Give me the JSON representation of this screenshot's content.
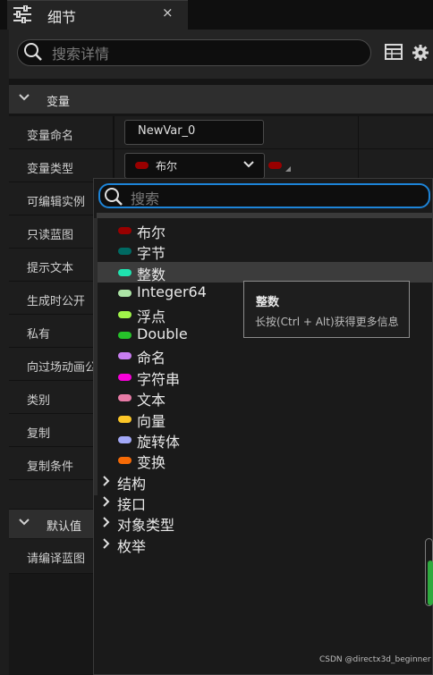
{
  "tab": {
    "title": "细节",
    "close_label": "×",
    "icon": "sliders-icon"
  },
  "search": {
    "placeholder": "搜索详情",
    "icon": "search-icon"
  },
  "toolbar": {
    "table_icon": "table-icon",
    "gear_icon": "gear-icon"
  },
  "variable_category": {
    "label": "变量"
  },
  "rows": [
    {
      "label": "变量命名"
    },
    {
      "label": "变量类型"
    },
    {
      "label": "可编辑实例"
    },
    {
      "label": "只读蓝图"
    },
    {
      "label": "提示文本"
    },
    {
      "label": "生成时公开"
    },
    {
      "label": "私有"
    },
    {
      "label": "向过场动画公"
    },
    {
      "label": "类别"
    },
    {
      "label": "复制"
    },
    {
      "label": "复制条件"
    }
  ],
  "variable_name": {
    "value": "NewVar_0"
  },
  "variable_type": {
    "value": "布尔",
    "color": "#990000"
  },
  "default_category": {
    "label": "默认值"
  },
  "compile_row": {
    "label": "请编译蓝图"
  },
  "type_picker": {
    "search_placeholder": "搜索",
    "types": [
      {
        "label": "布尔",
        "color": "#990000"
      },
      {
        "label": "字节",
        "color": "#006a63"
      },
      {
        "label": "整数",
        "color": "#1fe3b0"
      },
      {
        "label": "Integer64",
        "color": "#ace3a6"
      },
      {
        "label": "浮点",
        "color": "#a1f54a"
      },
      {
        "label": "Double",
        "color": "#26c22a"
      },
      {
        "label": "命名",
        "color": "#c87ef0"
      },
      {
        "label": "字符串",
        "color": "#f700d8"
      },
      {
        "label": "文本",
        "color": "#e77ba6"
      },
      {
        "label": "向量",
        "color": "#fcc627"
      },
      {
        "label": "旋转体",
        "color": "#a3a9f8"
      },
      {
        "label": "变换",
        "color": "#f66a06"
      }
    ],
    "selected_index": 2,
    "groups": [
      {
        "label": "结构"
      },
      {
        "label": "接口"
      },
      {
        "label": "对象类型"
      },
      {
        "label": "枚举"
      }
    ]
  },
  "tooltip": {
    "title": "整数",
    "hint": "长按(Ctrl + Alt)获得更多信息"
  },
  "watermark": "CSDN @directx3d_beginner"
}
